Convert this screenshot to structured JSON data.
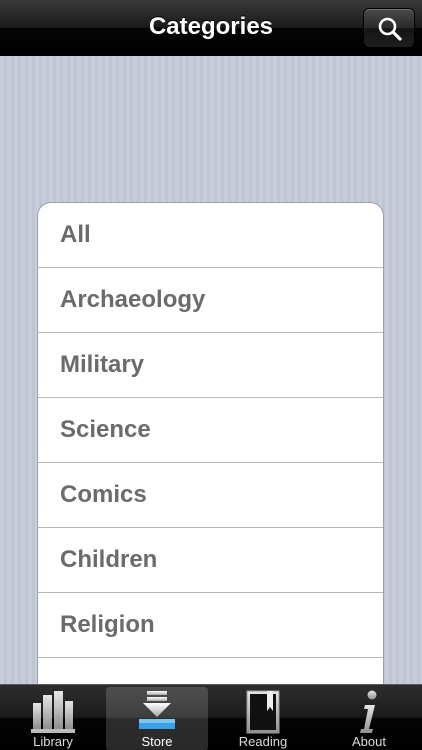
{
  "navbar": {
    "title": "Categories",
    "search_icon": "search-icon"
  },
  "categories": [
    {
      "label": "All"
    },
    {
      "label": "Archaeology"
    },
    {
      "label": "Military"
    },
    {
      "label": "Science"
    },
    {
      "label": "Comics"
    },
    {
      "label": "Children"
    },
    {
      "label": "Religion"
    }
  ],
  "tabbar": {
    "tabs": [
      {
        "label": "Library",
        "icon": "library-icon",
        "active": false
      },
      {
        "label": "Store",
        "icon": "store-download-icon",
        "active": true
      },
      {
        "label": "Reading",
        "icon": "reading-book-icon",
        "active": false
      },
      {
        "label": "About",
        "icon": "info-icon",
        "active": false
      }
    ]
  },
  "colors": {
    "background": "#c5cbd6",
    "navbar": "#1a1a1a",
    "item_text": "#6b6b6b",
    "accent_blue": "#3aa0e8"
  }
}
